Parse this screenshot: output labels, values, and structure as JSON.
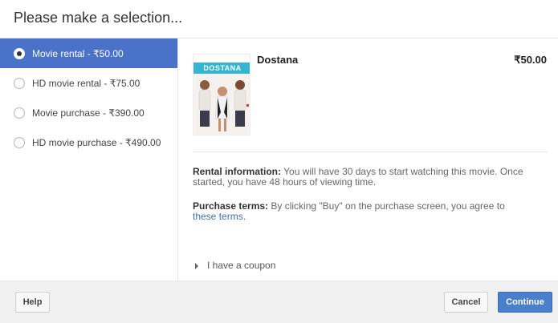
{
  "dialog": {
    "title": "Please make a selection..."
  },
  "options": [
    {
      "label": "Movie rental - ₹50.00",
      "selected": true
    },
    {
      "label": "HD movie rental - ₹75.00",
      "selected": false
    },
    {
      "label": "Movie purchase - ₹390.00",
      "selected": false
    },
    {
      "label": "HD movie purchase - ₹490.00",
      "selected": false
    }
  ],
  "movie": {
    "title": "Dostana",
    "price": "₹50.00",
    "poster_text": "DOSTANA"
  },
  "rental_info": {
    "label": "Rental information:",
    "text": "You will have 30 days to start watching this movie. Once started, you have 48 hours of viewing time."
  },
  "purchase_terms": {
    "label": "Purchase terms:",
    "text": "By clicking \"Buy\" on the purchase screen, you agree to",
    "link": "these terms",
    "after": "."
  },
  "coupon": {
    "label": "I have a coupon"
  },
  "footer": {
    "help": "Help",
    "cancel": "Cancel",
    "continue": "Continue"
  },
  "colors": {
    "selected_bg": "#4a72c9",
    "primary_button": "#4a7fcb",
    "link": "#3d6fb6"
  }
}
